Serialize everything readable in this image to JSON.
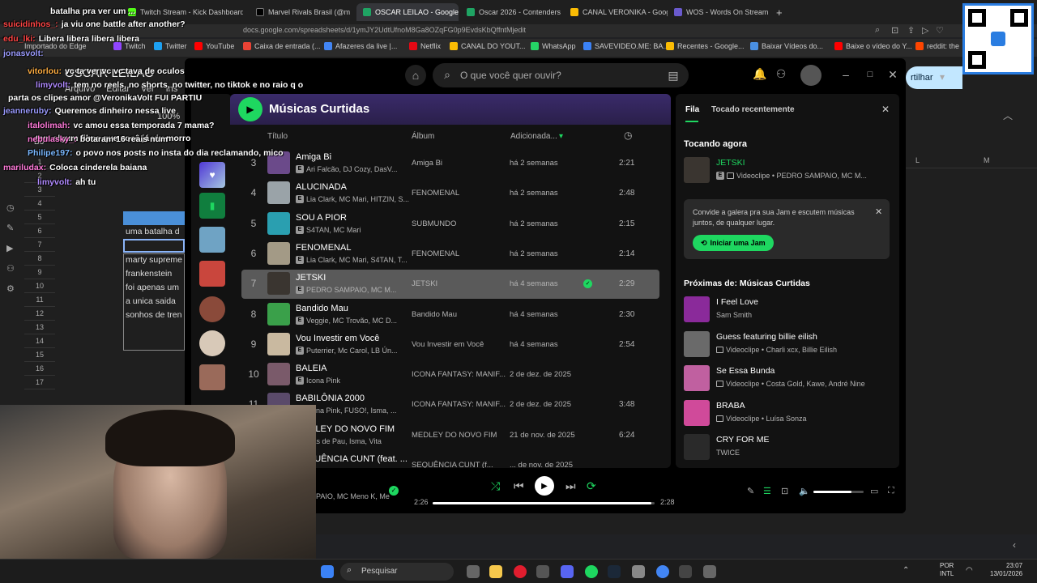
{
  "browser": {
    "tabs": [
      {
        "label": "Twitch Stream - Kick Dashboard",
        "active": false
      },
      {
        "label": "Marvel Rivals Brasil (@m",
        "active": false
      },
      {
        "label": "OSCAR LEILAO - Google S",
        "active": true
      },
      {
        "label": "Oscar 2026 - Contenders",
        "active": false
      },
      {
        "label": "CANAL VERONIKA - Goog",
        "active": false
      },
      {
        "label": "WOS - Words On Stream",
        "active": false
      }
    ],
    "address": "docs.google.com/spreadsheets/d/1ymJY2UdtUfnoM8Ga8OZqFG0p9EvdsKbQffntMjedit",
    "bookmarks": [
      "Importado do Edge",
      "Twitch",
      "Twitter",
      "YouTube",
      "Caixa de entrada (...",
      "Afazeres da live |...",
      "Netflix",
      "CANAL DO YOUT...",
      "WhatsApp",
      "SAVEVIDEO.ME: BA...",
      "Recentes - Google...",
      "Baixar Vídeos do...",
      "Baixe o vídeo do Y...",
      "reddit: the"
    ]
  },
  "sheet": {
    "title": "OSCAR LEILAO",
    "menu": [
      "Arquivo",
      "Editar",
      "Ver",
      "Ins"
    ],
    "zoom": "100%",
    "cell_ref": "B6",
    "share_label": "rtilhar",
    "columns": [
      "L",
      "M"
    ],
    "rows": [
      "1",
      "2",
      "3",
      "4",
      "5",
      "6",
      "7",
      "8",
      "9",
      "10",
      "11",
      "12",
      "13",
      "14",
      "15",
      "16",
      "17"
    ],
    "cells": [
      "uma batalha d",
      "marty supreme",
      "frankenstein",
      "foi apenas um",
      "a unica saida",
      "sonhos de tren"
    ]
  },
  "chat": [
    {
      "user": "",
      "msg": "batalha pra ver um ...",
      "color": "#e06cf0"
    },
    {
      "user": "suicidinhos_:",
      "msg": "ja viu one battle after another?",
      "color": "#ff4444"
    },
    {
      "user": "edu_lki:",
      "msg": "Libera libera libera libera",
      "color": "#ff4444"
    },
    {
      "user": "jonasvolt:",
      "msg": "",
      "color": "#9b9bff"
    },
    {
      "user": "vitorlou:",
      "msg": "vc ta ver vc vc tava de oculos",
      "color": "#ffae42"
    },
    {
      "user": "limyvolt:",
      "msg": "tem no reels, no shorts, no twitter, no tiktok e no raio q o",
      "color": "#b08aff"
    },
    {
      "user": "",
      "msg": "parta os clipes amor @VeronikaVolt FUI PARTIU",
      "color": "#ffffff"
    },
    {
      "user": "jeanneruby:",
      "msg": "Queremos dinheiro nessa live",
      "color": "#9b9bff"
    },
    {
      "user": "italolimah:",
      "msg": "vc amou essa temporada 7 mama?",
      "color": "#ff7ad9"
    },
    {
      "user": "",
      "msg": "tem algum filme que você já viu morro",
      "color": "#ffffff"
    },
    {
      "user": "nebulasky_:",
      "msg": "botaram 16 reais num",
      "color": "#ff7ad9"
    },
    {
      "user": "Philipe197:",
      "msg": "o povo nos posts no insta do dia reclamando, mico",
      "color": "#7ab8ff"
    },
    {
      "user": "mariludax:",
      "msg": "Coloca cinderela baiana",
      "color": "#ff7ad9"
    },
    {
      "user": "limyvolt:",
      "msg": "ah tu",
      "color": "#b08aff"
    }
  ],
  "spotify": {
    "search_placeholder": "O que você quer ouvir?",
    "playlist_title": "Músicas Curtidas",
    "columns": {
      "title": "Título",
      "album": "Álbum",
      "added": "Adicionada..."
    },
    "tracks": [
      {
        "n": "3",
        "title": "Amiga Bi",
        "artists": "Ari Falcão, DJ Cozy, DasV...",
        "album": "Amiga Bi",
        "added": "há 2 semanas",
        "dur": "2:21",
        "color": "#6b4a8a"
      },
      {
        "n": "4",
        "title": "ALUCINADA",
        "artists": "Lia Clark, MC Mari, HITZIN, S...",
        "album": "FENOMENAL",
        "added": "há 2 semanas",
        "dur": "2:48",
        "color": "#9aa3a8"
      },
      {
        "n": "5",
        "title": "SOU A PIOR",
        "artists": "S4TAN, MC Mari",
        "album": "SUBMUNDO",
        "added": "há 2 semanas",
        "dur": "2:15",
        "color": "#2a9fb0"
      },
      {
        "n": "6",
        "title": "FENOMENAL",
        "artists": "Lia Clark, MC Mari, S4TAN, T...",
        "album": "FENOMENAL",
        "added": "há 2 semanas",
        "dur": "2:14",
        "color": "#a39a86"
      },
      {
        "n": "7",
        "title": "JETSKI",
        "artists": "PEDRO SAMPAIO, MC M...",
        "album": "JETSKI",
        "added": "há 4 semanas",
        "dur": "2:29",
        "color": "#3a3530",
        "selected": true
      },
      {
        "n": "8",
        "title": "Bandido Mau",
        "artists": "Veggie, MC Trovão, MC D...",
        "album": "Bandido Mau",
        "added": "há 4 semanas",
        "dur": "2:30",
        "color": "#3aa04a"
      },
      {
        "n": "9",
        "title": "Vou Investir em Você",
        "artists": "Puterrier, Mc Carol, LB Ún...",
        "album": "Vou Investir em Você",
        "added": "há 4 semanas",
        "dur": "2:54",
        "color": "#c9b9a0"
      },
      {
        "n": "10",
        "title": "BALEIA",
        "artists": "Icona Pink",
        "album": "ICONA FANTASY: MANIF...",
        "added": "2 de dez. de 2025",
        "dur": "",
        "color": "#7a5a6a"
      },
      {
        "n": "11",
        "title": "BABILÔNIA 2000",
        "artists": "Icona Pink, FUSO!, Isma, ...",
        "album": "ICONA FANTASY: MANIF...",
        "added": "2 de dez. de 2025",
        "dur": "3:48",
        "color": "#5a4a6a"
      },
      {
        "n": "12",
        "title": "MEDLEY DO NOVO FIM",
        "artists": "Mãs de Pau, Isma, Vita",
        "album": "MEDLEY DO NOVO FIM",
        "added": "21 de nov. de 2025",
        "dur": "6:24",
        "color": "#4a4a5a"
      },
      {
        "n": "13",
        "title": "SEQUÊNCIA CUNT (feat. ...",
        "artists": "",
        "album": "SEQUÊNCIA CUNT (f...",
        "added": "... de nov. de 2025",
        "dur": "",
        "color": "#5a3a4a"
      }
    ],
    "queue": {
      "tab_queue": "Fila",
      "tab_recent": "Tocado recentemente",
      "now_playing_label": "Tocando agora",
      "now_playing": {
        "title": "JETSKI",
        "sub": "Videoclipe • PEDRO SAMPAIO, MC M..."
      },
      "jam_text": "Convide a galera pra sua Jam e escutem músicas juntos, de qualquer lugar.",
      "jam_button": "Iniciar uma Jam",
      "next_label": "Próximas de: Músicas Curtidas",
      "next": [
        {
          "title": "I Feel Love",
          "sub": "Sam Smith",
          "video": false,
          "color": "#8a2a9a"
        },
        {
          "title": "Guess featuring billie eilish",
          "sub": "Videoclipe • Charli xcx, Billie Eilish",
          "video": true,
          "color": "#6a6a6a"
        },
        {
          "title": "Se Essa Bunda",
          "sub": "Videoclipe • Costa Gold, Kawe, André Nine",
          "video": true,
          "color": "#c060a0"
        },
        {
          "title": "BRABA",
          "sub": "Videoclipe • Luísa Sonza",
          "video": true,
          "color": "#d04a9a"
        },
        {
          "title": "CRY FOR ME",
          "sub": "TWICE",
          "video": false,
          "color": "#2a2a2a"
        }
      ]
    },
    "player": {
      "elapsed": "2:26",
      "total": "2:28",
      "progress": 0.986,
      "now_artists": "PAIO, MC Meno K, Me",
      "volume": 0.75
    }
  },
  "taskbar": {
    "search": "Pesquisar",
    "lang": "POR",
    "layout": "INTL",
    "time": "23:07",
    "date": "13/01/2026"
  }
}
